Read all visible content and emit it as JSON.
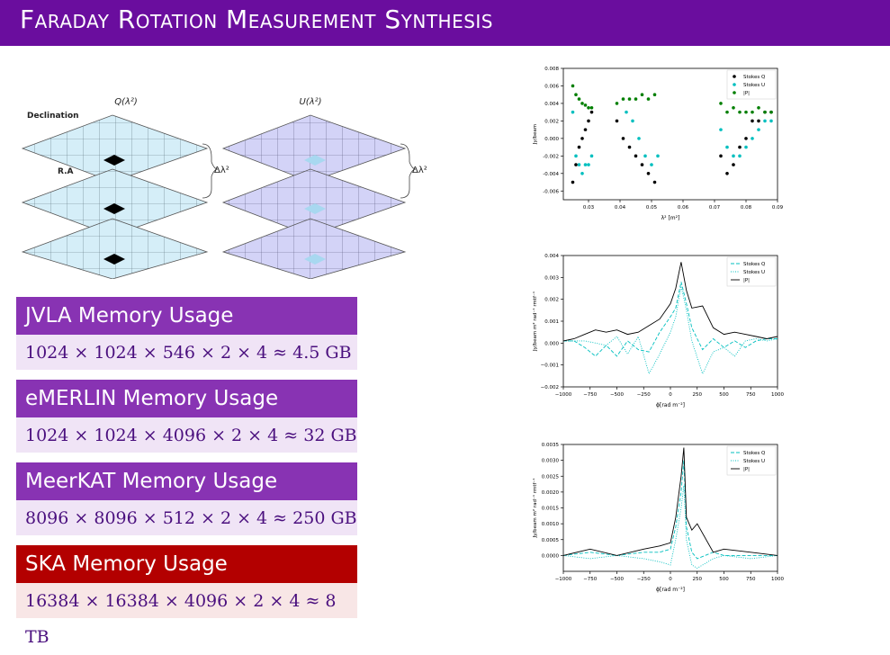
{
  "title": "Faraday Rotation Measurement Synthesis",
  "cube": {
    "q_label": "Q(λ²)",
    "u_label": "U(λ²)",
    "dec_label": "Declination",
    "ra_label": "R.A",
    "delta_label_left": "Δλ²",
    "delta_label_right": "Δλ²"
  },
  "memory_boxes": [
    {
      "title": "JVLA Memory Usage",
      "formula": "1024 × 1024 × 546 × 2 × 4 ≈ 4.5 GB"
    },
    {
      "title": "eMERLIN Memory Usage",
      "formula": "1024 × 1024 × 4096 × 2 × 4 ≈ 32 GB"
    },
    {
      "title": "MeerKAT Memory Usage",
      "formula": "8096 × 8096 × 512 × 2 × 4 ≈ 250 GB"
    },
    {
      "title": "SKA Memory Usage",
      "formula": "16384 × 16384 × 4096 × 2 × 4 ≈ 8 TB"
    }
  ],
  "colors": {
    "title_bg": "#6a0d9e",
    "box_purple": "#8833b3",
    "box_red": "#b30000",
    "stokes_q": "#000000",
    "stokes_u": "#00c0c0",
    "p": "#008000"
  },
  "chart_data": [
    {
      "type": "scatter",
      "xlabel": "λ² [m²]",
      "ylabel": "Jy/beam",
      "xlim": [
        0.022,
        0.09
      ],
      "ylim": [
        -0.007,
        0.008
      ],
      "xticks": [
        "0.03",
        "0.04",
        "0.05",
        "0.06",
        "0.07",
        "0.08",
        "0.09"
      ],
      "yticks": [
        "-0.006",
        "-0.004",
        "-0.002",
        "0.000",
        "0.002",
        "0.004",
        "0.006",
        "0.008"
      ],
      "legend": [
        "Stokes Q",
        "Stokes U",
        "|P|"
      ],
      "legend_position": "top-right",
      "series": [
        {
          "name": "Stokes Q",
          "points": [
            [
              0.025,
              -0.005
            ],
            [
              0.026,
              -0.003
            ],
            [
              0.027,
              -0.001
            ],
            [
              0.028,
              0.0
            ],
            [
              0.029,
              0.001
            ],
            [
              0.03,
              0.002
            ],
            [
              0.031,
              0.003
            ],
            [
              0.039,
              0.002
            ],
            [
              0.041,
              0.0
            ],
            [
              0.043,
              -0.001
            ],
            [
              0.045,
              -0.002
            ],
            [
              0.047,
              -0.003
            ],
            [
              0.049,
              -0.004
            ],
            [
              0.051,
              -0.005
            ],
            [
              0.072,
              -0.002
            ],
            [
              0.074,
              -0.004
            ],
            [
              0.076,
              -0.003
            ],
            [
              0.078,
              -0.001
            ],
            [
              0.08,
              0.0
            ],
            [
              0.082,
              0.002
            ],
            [
              0.084,
              0.002
            ],
            [
              0.086,
              0.003
            ],
            [
              0.088,
              0.003
            ]
          ]
        },
        {
          "name": "Stokes U",
          "points": [
            [
              0.025,
              0.003
            ],
            [
              0.026,
              -0.002
            ],
            [
              0.027,
              -0.003
            ],
            [
              0.028,
              -0.004
            ],
            [
              0.029,
              -0.003
            ],
            [
              0.03,
              -0.003
            ],
            [
              0.031,
              -0.002
            ],
            [
              0.042,
              0.003
            ],
            [
              0.044,
              0.002
            ],
            [
              0.046,
              0.0
            ],
            [
              0.048,
              -0.002
            ],
            [
              0.05,
              -0.003
            ],
            [
              0.052,
              -0.002
            ],
            [
              0.072,
              0.001
            ],
            [
              0.074,
              -0.001
            ],
            [
              0.076,
              -0.002
            ],
            [
              0.078,
              -0.002
            ],
            [
              0.08,
              -0.001
            ],
            [
              0.082,
              0.0
            ],
            [
              0.084,
              0.001
            ],
            [
              0.086,
              0.002
            ],
            [
              0.088,
              0.002
            ]
          ]
        },
        {
          "name": "|P|",
          "points": [
            [
              0.025,
              0.006
            ],
            [
              0.026,
              0.005
            ],
            [
              0.027,
              0.0045
            ],
            [
              0.028,
              0.004
            ],
            [
              0.029,
              0.0038
            ],
            [
              0.03,
              0.0035
            ],
            [
              0.031,
              0.0035
            ],
            [
              0.039,
              0.004
            ],
            [
              0.041,
              0.0045
            ],
            [
              0.043,
              0.0045
            ],
            [
              0.045,
              0.0045
            ],
            [
              0.047,
              0.005
            ],
            [
              0.049,
              0.0045
            ],
            [
              0.051,
              0.005
            ],
            [
              0.072,
              0.004
            ],
            [
              0.074,
              0.003
            ],
            [
              0.076,
              0.0035
            ],
            [
              0.078,
              0.003
            ],
            [
              0.08,
              0.003
            ],
            [
              0.082,
              0.003
            ],
            [
              0.084,
              0.0035
            ],
            [
              0.086,
              0.003
            ],
            [
              0.088,
              0.003
            ]
          ]
        }
      ]
    },
    {
      "type": "line",
      "xlabel": "ϕ[rad m⁻²]",
      "ylabel": "Jy/beam m² rad⁻¹ rmtf⁻¹",
      "xlim": [
        -1000,
        1000
      ],
      "ylim": [
        -0.002,
        0.004
      ],
      "xticks": [
        "−1000",
        "−750",
        "−500",
        "−250",
        "0",
        "250",
        "500",
        "750",
        "1000"
      ],
      "yticks": [
        "−0.002",
        "−0.001",
        "0.000",
        "0.001",
        "0.002",
        "0.003",
        "0.004"
      ],
      "legend": [
        "Stokes Q",
        "Stokes U",
        "|P|"
      ],
      "legend_position": "top-right",
      "series": [
        {
          "name": "Stokes Q",
          "x": [
            -1000,
            -900,
            -800,
            -700,
            -600,
            -500,
            -400,
            -300,
            -200,
            -100,
            0,
            50,
            100,
            150,
            200,
            300,
            400,
            500,
            600,
            700,
            800,
            900,
            1000
          ],
          "values": [
            0.0001,
            0.0001,
            -0.0002,
            -0.0006,
            -0.0001,
            -0.0006,
            0.0001,
            -0.0003,
            -0.0004,
            0.0005,
            0.0012,
            0.0016,
            0.0028,
            0.0018,
            0.0007,
            -0.0003,
            0.0002,
            -0.0002,
            0.0001,
            -0.0002,
            0.0001,
            0.0002,
            0.0002
          ]
        },
        {
          "name": "Stokes U",
          "x": [
            -1000,
            -900,
            -800,
            -700,
            -600,
            -500,
            -400,
            -300,
            -200,
            -100,
            0,
            50,
            100,
            150,
            200,
            300,
            400,
            500,
            600,
            700,
            800,
            900,
            1000
          ],
          "values": [
            0.0001,
            0.0001,
            0.0001,
            0.0,
            -0.0001,
            0.0003,
            -0.0005,
            0.0003,
            -0.0014,
            -0.0005,
            0.0005,
            0.0012,
            0.0026,
            0.0015,
            0.0001,
            -0.0014,
            -0.0004,
            -0.0002,
            -0.0006,
            0.0001,
            0.0002,
            0.0001,
            0.0002
          ]
        },
        {
          "name": "|P|",
          "x": [
            -1000,
            -900,
            -800,
            -700,
            -600,
            -500,
            -400,
            -300,
            -200,
            -100,
            0,
            50,
            100,
            150,
            200,
            300,
            400,
            500,
            600,
            700,
            800,
            900,
            1000
          ],
          "values": [
            0.0001,
            0.0002,
            0.0004,
            0.0006,
            0.0005,
            0.0006,
            0.0004,
            0.0005,
            0.0008,
            0.0011,
            0.0018,
            0.0025,
            0.0037,
            0.0024,
            0.0016,
            0.0017,
            0.0007,
            0.0004,
            0.0005,
            0.0004,
            0.0003,
            0.0002,
            0.0003
          ]
        }
      ]
    },
    {
      "type": "line",
      "xlabel": "ϕ[rad m⁻²]",
      "ylabel": "Jy/beam m² rad⁻¹ rmtf⁻¹",
      "xlim": [
        -1000,
        1000
      ],
      "ylim": [
        -0.0005,
        0.0035
      ],
      "xticks": [
        "−1000",
        "−750",
        "−500",
        "−250",
        "0",
        "250",
        "500",
        "750",
        "1000"
      ],
      "yticks": [
        "0.0000",
        "0.0005",
        "0.0010",
        "0.0015",
        "0.0020",
        "0.0025",
        "0.0030",
        "0.0035"
      ],
      "legend": [
        "Stokes Q",
        "Stokes U",
        "|P|"
      ],
      "legend_position": "top-right",
      "series": [
        {
          "name": "Stokes Q",
          "x": [
            -1000,
            -750,
            -500,
            -250,
            -100,
            0,
            50,
            100,
            125,
            150,
            200,
            250,
            400,
            500,
            750,
            1000
          ],
          "values": [
            0.0,
            0.0001,
            0.0,
            0.0001,
            0.0001,
            0.0002,
            0.0009,
            0.002,
            0.003,
            0.0009,
            0.0001,
            -0.0001,
            0.0001,
            0.0,
            0.0,
            0.0
          ]
        },
        {
          "name": "Stokes U",
          "x": [
            -1000,
            -750,
            -500,
            -250,
            -100,
            0,
            50,
            100,
            125,
            150,
            200,
            250,
            400,
            500,
            750,
            1000
          ],
          "values": [
            0.0,
            -0.0001,
            0.0,
            -0.0001,
            -0.0002,
            -0.0003,
            0.0005,
            0.0015,
            0.0022,
            0.0005,
            -0.0003,
            -0.0004,
            -0.0001,
            0.0,
            -0.0001,
            0.0
          ]
        },
        {
          "name": "|P|",
          "x": [
            -1000,
            -750,
            -500,
            -250,
            -100,
            0,
            50,
            100,
            125,
            150,
            200,
            250,
            400,
            500,
            750,
            1000
          ],
          "values": [
            0.0,
            0.0002,
            0.0,
            0.0002,
            0.0003,
            0.0004,
            0.0012,
            0.0025,
            0.0034,
            0.0012,
            0.0008,
            0.001,
            0.0001,
            0.0002,
            0.0001,
            0.0
          ]
        }
      ]
    }
  ]
}
